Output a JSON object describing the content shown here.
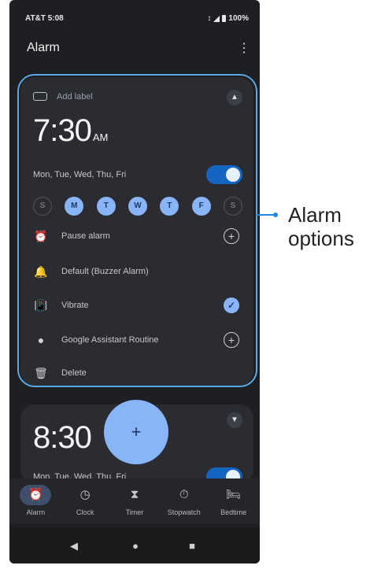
{
  "status_bar": {
    "carrier_time": "AT&T 5:08",
    "battery": "100%"
  },
  "app_bar": {
    "title": "Alarm",
    "menu_icon": "more-vert-icon"
  },
  "alarm1": {
    "label_placeholder": "Add label",
    "time": "7:30",
    "ampm": "AM",
    "repeat_days": "Mon, Tue, Wed, Thu, Fri",
    "enabled": true,
    "days": [
      {
        "letter": "S",
        "on": false
      },
      {
        "letter": "M",
        "on": true
      },
      {
        "letter": "T",
        "on": true
      },
      {
        "letter": "W",
        "on": true
      },
      {
        "letter": "T",
        "on": true
      },
      {
        "letter": "F",
        "on": true
      },
      {
        "letter": "S",
        "on": false
      }
    ],
    "options": {
      "pause": "Pause alarm",
      "sound": "Default (Buzzer Alarm)",
      "vibrate": "Vibrate",
      "assistant": "Google Assistant Routine",
      "delete": "Delete"
    }
  },
  "alarm2": {
    "time": "8:30",
    "repeat_days": "Mon, Tue, Wed, Thu, Fri",
    "enabled": true
  },
  "fab_label": "+",
  "bottom_nav": [
    {
      "label": "Alarm",
      "icon": "alarm-icon",
      "active": true
    },
    {
      "label": "Clock",
      "icon": "clock-icon",
      "active": false
    },
    {
      "label": "Timer",
      "icon": "hourglass-icon",
      "active": false
    },
    {
      "label": "Stopwatch",
      "icon": "stopwatch-icon",
      "active": false
    },
    {
      "label": "Bedtime",
      "icon": "bed-icon",
      "active": false
    }
  ],
  "callout": {
    "line1": "Alarm",
    "line2": "options",
    "color": "#1e88e5"
  },
  "colors": {
    "accent": "#8ab4f8",
    "toggle_on": "#1565c0",
    "background": "#1e1f22"
  }
}
